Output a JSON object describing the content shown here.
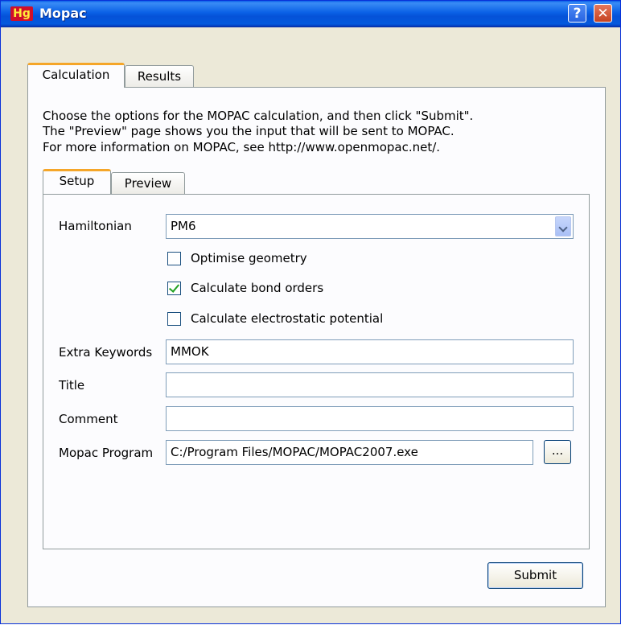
{
  "window": {
    "title": "Mopac",
    "app_icon_text": "Hg",
    "help_label": "?",
    "close_label": "✕"
  },
  "tabs": [
    {
      "label": "Calculation",
      "active": true
    },
    {
      "label": "Results",
      "active": false
    }
  ],
  "description": [
    "Choose the options for the MOPAC calculation, and then click \"Submit\".",
    "The \"Preview\" page shows you the input that will be sent to MOPAC.",
    "For more information on MOPAC, see http://www.openmopac.net/."
  ],
  "subtabs": [
    {
      "label": "Setup",
      "active": true
    },
    {
      "label": "Preview",
      "active": false
    }
  ],
  "form": {
    "hamiltonian_label": "Hamiltonian",
    "hamiltonian_value": "PM6",
    "optimise_label": "Optimise geometry",
    "optimise_checked": false,
    "bond_orders_label": "Calculate bond orders",
    "bond_orders_checked": true,
    "esp_label": "Calculate electrostatic potential",
    "esp_checked": false,
    "extra_keywords_label": "Extra Keywords",
    "extra_keywords_value": "MMOK",
    "title_label": "Title",
    "title_value": "",
    "comment_label": "Comment",
    "comment_value": "",
    "program_label": "Mopac Program",
    "program_value": "C:/Program Files/MOPAC/MOPAC2007.exe",
    "browse_label": "..."
  },
  "submit_label": "Submit"
}
